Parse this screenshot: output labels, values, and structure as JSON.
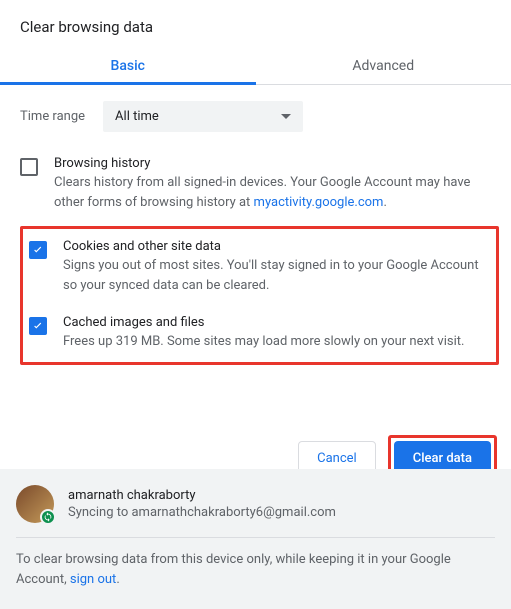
{
  "title": "Clear browsing data",
  "tabs": {
    "basic": "Basic",
    "advanced": "Advanced"
  },
  "time": {
    "label": "Time range",
    "value": "All time"
  },
  "opts": {
    "history": {
      "title": "Browsing history",
      "desc_pre": "Clears history from all signed-in devices. Your Google Account may have other forms of browsing history at ",
      "link": "myactivity.google.com",
      "desc_post": "."
    },
    "cookies": {
      "title": "Cookies and other site data",
      "desc": "Signs you out of most sites. You'll stay signed in to your Google Account so your synced data can be cleared."
    },
    "cache": {
      "title": "Cached images and files",
      "desc": "Frees up 319 MB. Some sites may load more slowly on your next visit."
    }
  },
  "buttons": {
    "cancel": "Cancel",
    "clear": "Clear data"
  },
  "account": {
    "name": "amarnath chakraborty",
    "sync": "Syncing to amarnathchakraborty6@gmail.com"
  },
  "footer": {
    "text_pre": "To clear browsing data from this device only, while keeping it in your Google Account, ",
    "link": "sign out",
    "text_post": "."
  }
}
